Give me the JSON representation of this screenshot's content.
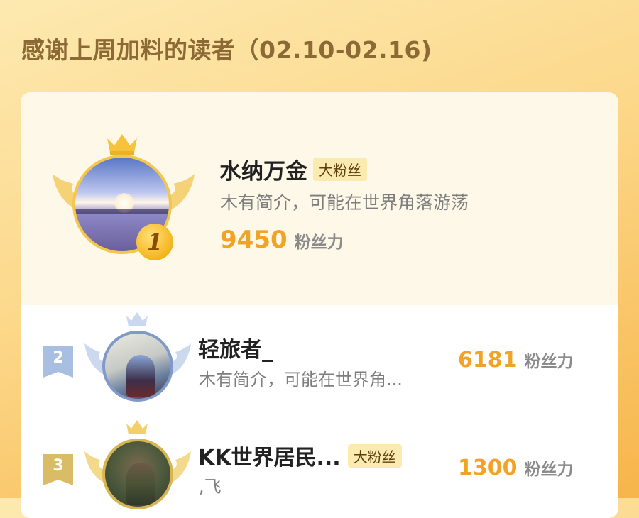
{
  "header": {
    "title": "感谢上周加料的读者（02.10-02.16)"
  },
  "leaderboard": {
    "top": {
      "rank": "1",
      "name": "水纳万金",
      "badge": "大粉丝",
      "bio": "木有简介，可能在世界角落游荡",
      "score": "9450",
      "score_unit": "粉丝力"
    },
    "rows": [
      {
        "rank": "2",
        "name": "轻旅者_",
        "badge": "",
        "bio": "木有简介，可能在世界角...",
        "score": "6181",
        "score_unit": "粉丝力",
        "medal_color": "#a9bfe2"
      },
      {
        "rank": "3",
        "name": "KK世界居民...",
        "badge": "大粉丝",
        "bio": ",飞",
        "score": "1300",
        "score_unit": "粉丝力",
        "medal_color": "#d9bc65"
      }
    ]
  },
  "colors": {
    "accent": "#f2a326",
    "gold": "#f4c64b",
    "silver": "#a9bfe2",
    "bronze": "#d9bc65",
    "badge_bg": "#fcebb0"
  },
  "icons": [
    "crown-icon",
    "wing-icon",
    "rank-1-medal-icon",
    "rank-2-ribbon-icon",
    "rank-3-ribbon-icon"
  ]
}
